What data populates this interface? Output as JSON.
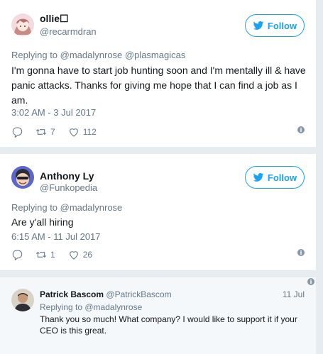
{
  "tweets": [
    {
      "name": "ollie☐",
      "handle": "@recarmdran",
      "follow_label": "Follow",
      "replying_to": "Replying to @madalynrose @plasmagicas",
      "text": "I'm gonna have to start job hunting soon and I'm mentally ill & have panic attacks. Thanks for giving me hope that I can find a job as I am.",
      "timestamp": "3:02 AM - 3 Jul 2017",
      "retweets": "7",
      "likes": "112"
    },
    {
      "name": "Anthony Ly",
      "handle": "@Funkopedia",
      "follow_label": "Follow",
      "replying_to": "Replying to @madalynrose",
      "text": "Are y'all hiring",
      "timestamp": "6:15 AM - 11 Jul 2017",
      "retweets": "1",
      "likes": "26"
    },
    {
      "name": "Patrick Bascom",
      "handle": "@PatrickBascom",
      "date": "11 Jul",
      "replying_to": "Replying to @madalynrose",
      "text": "Thank you so much! What company? I would like to support it if your CEO is this great."
    }
  ],
  "colors": {
    "accent": "#1da1f2",
    "muted": "#657786",
    "background": "#e6ecf0"
  },
  "icons": [
    "twitter-bird-icon",
    "reply-icon",
    "retweet-icon",
    "like-icon",
    "more-info-icon"
  ]
}
